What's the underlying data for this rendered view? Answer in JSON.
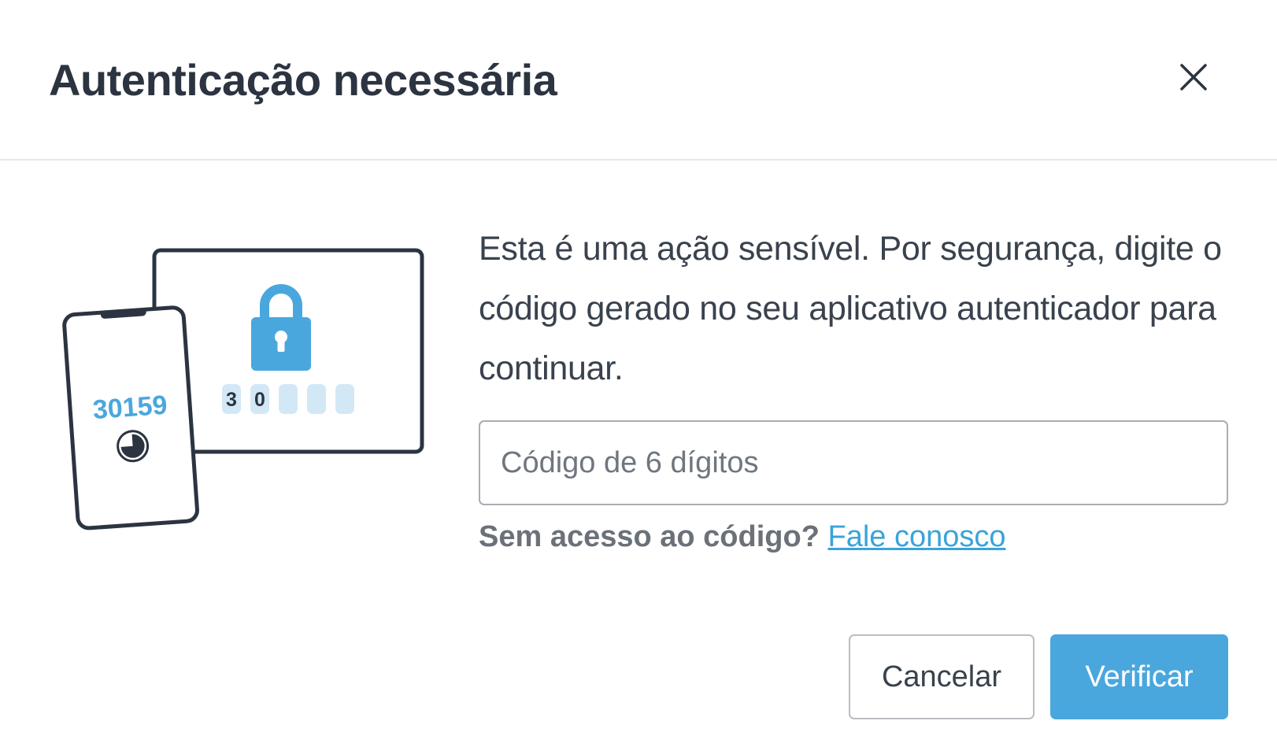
{
  "dialog": {
    "title": "Autenticação necessária",
    "close_icon": "close-icon",
    "illustration": {
      "phone_code": "30159",
      "screen_digits": [
        "3",
        "0",
        "",
        "",
        ""
      ]
    },
    "message": "Esta é uma ação sensível. Por segurança, digite o código gerado no seu aplicativo autenticador para continuar.",
    "code_input": {
      "value": "",
      "placeholder": "Código de 6 dígitos"
    },
    "help": {
      "text": "Sem acesso ao código?",
      "link": "Fale conosco"
    },
    "buttons": {
      "cancel": "Cancelar",
      "verify": "Verificar"
    }
  },
  "colors": {
    "accent": "#4aa7de",
    "link": "#3aa3db",
    "title": "#2b3440",
    "illustration_outline": "#2b3440",
    "digit_box": "#d3e8f6"
  }
}
